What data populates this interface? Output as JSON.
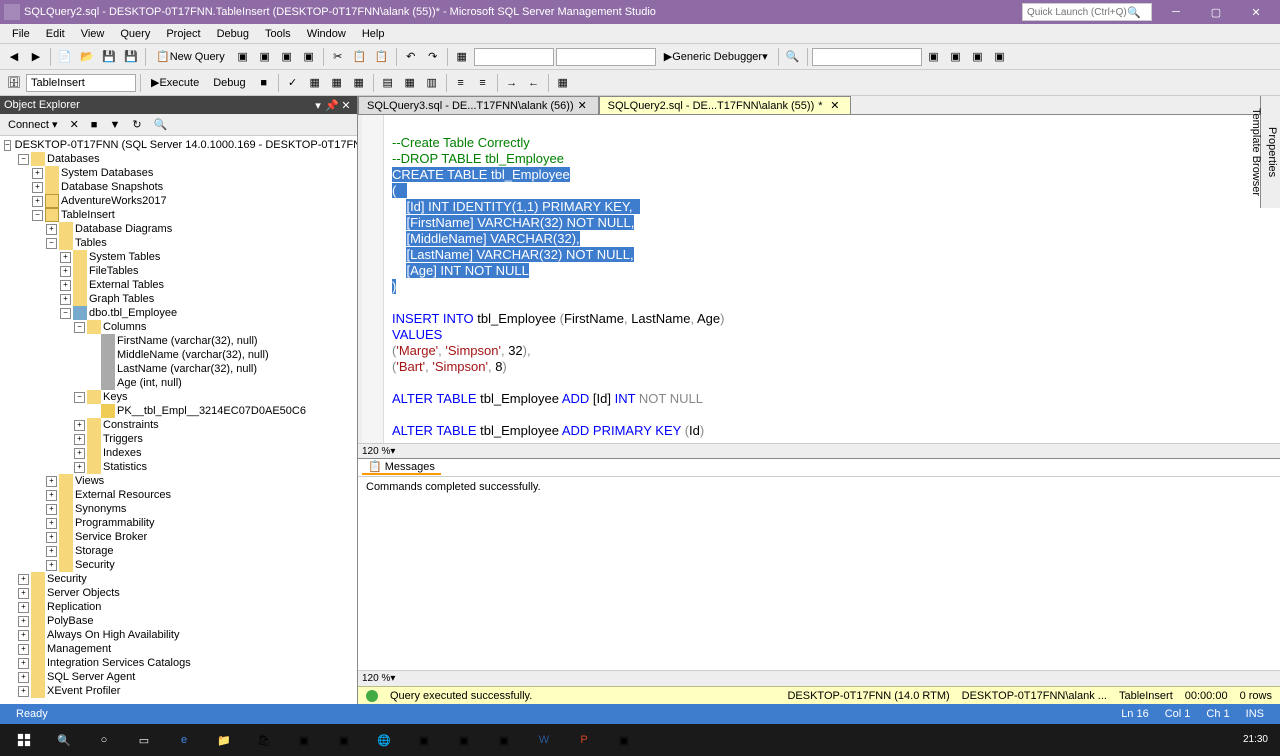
{
  "window": {
    "title": "SQLQuery2.sql - DESKTOP-0T17FNN.TableInsert (DESKTOP-0T17FNN\\alank (55))* - Microsoft SQL Server Management Studio",
    "quick_launch_placeholder": "Quick Launch (Ctrl+Q)"
  },
  "menu": [
    "File",
    "Edit",
    "View",
    "Query",
    "Project",
    "Debug",
    "Tools",
    "Window",
    "Help"
  ],
  "toolbar": {
    "new_query": "New Query",
    "execute": "Execute",
    "debug": "Debug",
    "debugger": "Generic Debugger",
    "db_combo": "TableInsert"
  },
  "object_explorer": {
    "title": "Object Explorer",
    "connect": "Connect",
    "server": "DESKTOP-0T17FNN (SQL Server 14.0.1000.169 - DESKTOP-0T17FNN\\alank)",
    "nodes": {
      "databases": "Databases",
      "sysdb": "System Databases",
      "snapshots": "Database Snapshots",
      "adventure": "AdventureWorks2017",
      "tableinsert": "TableInsert",
      "dbdiagrams": "Database Diagrams",
      "tables": "Tables",
      "systables": "System Tables",
      "filetables": "FileTables",
      "exttables": "External Tables",
      "graphtables": "Graph Tables",
      "tbl_employee": "dbo.tbl_Employee",
      "columns": "Columns",
      "col_firstname": "FirstName (varchar(32), null)",
      "col_middlename": "MiddleName (varchar(32), null)",
      "col_lastname": "LastName (varchar(32), null)",
      "col_age": "Age (int, null)",
      "keys": "Keys",
      "pk": "PK__tbl_Empl__3214EC07D0AE50C6",
      "constraints": "Constraints",
      "triggers": "Triggers",
      "indexes": "Indexes",
      "statistics": "Statistics",
      "views": "Views",
      "extres": "External Resources",
      "synonyms": "Synonyms",
      "programmability": "Programmability",
      "servicebroker": "Service Broker",
      "storage": "Storage",
      "security": "Security",
      "security2": "Security",
      "serverobjects": "Server Objects",
      "replication": "Replication",
      "polybase": "PolyBase",
      "alwayson": "Always On High Availability",
      "management": "Management",
      "iscat": "Integration Services Catalogs",
      "agent": "SQL Server Agent",
      "xevent": "XEvent Profiler"
    }
  },
  "tabs": [
    {
      "label": "SQLQuery3.sql - DE...T17FNN\\alank (56))",
      "active": false,
      "dirty": false
    },
    {
      "label": "SQLQuery2.sql - DE...T17FNN\\alank (55))",
      "active": true,
      "dirty": true
    }
  ],
  "code": {
    "zoom": "120 %",
    "cmt1": "--Create Table Correctly",
    "cmt2": "--DROP TABLE tbl_Employee"
  },
  "messages": {
    "tab": "Messages",
    "text": "Commands completed successfully.",
    "zoom": "120 %"
  },
  "query_status": {
    "text": "Query executed successfully.",
    "server": "DESKTOP-0T17FNN (14.0 RTM)",
    "user": "DESKTOP-0T17FNN\\alank ...",
    "db": "TableInsert",
    "time": "00:00:00",
    "rows": "0 rows"
  },
  "statusbar": {
    "ready": "Ready",
    "ln": "Ln 16",
    "col": "Col 1",
    "ch": "Ch 1",
    "ins": "INS"
  },
  "sidetabs": {
    "properties": "Properties",
    "template": "Template Browser"
  },
  "clock": {
    "time": "21:30",
    "date": "21:30"
  }
}
